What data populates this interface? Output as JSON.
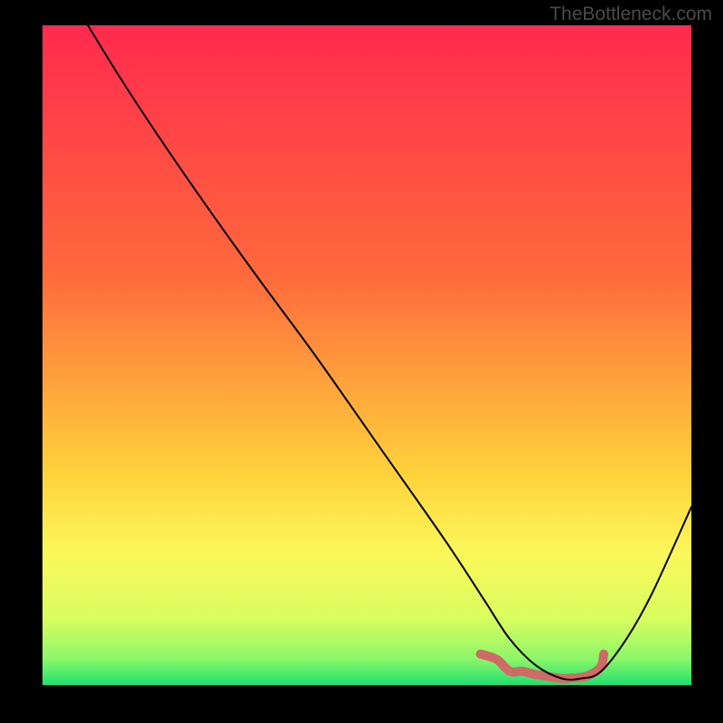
{
  "watermark": "TheBottleneck.com",
  "chart_data": {
    "type": "line",
    "title": "",
    "xlabel": "",
    "ylabel": "",
    "xlim": [
      0,
      100
    ],
    "ylim": [
      0,
      100
    ],
    "gradient_stops": [
      {
        "offset": 0,
        "color": "#ff2a4e"
      },
      {
        "offset": 38,
        "color": "#ff6a3c"
      },
      {
        "offset": 68,
        "color": "#ffd23b"
      },
      {
        "offset": 80,
        "color": "#fbf85a"
      },
      {
        "offset": 90,
        "color": "#d9fd5f"
      },
      {
        "offset": 96,
        "color": "#8cf76a"
      },
      {
        "offset": 100,
        "color": "#1fe071"
      }
    ],
    "curve": {
      "x": [
        7,
        12,
        18,
        25,
        33,
        42,
        52,
        62,
        68,
        72,
        76,
        80,
        83,
        86,
        90,
        94,
        100
      ],
      "values": [
        100,
        92,
        83,
        73,
        62,
        50,
        36,
        22,
        13,
        7,
        3,
        1,
        1,
        2,
        7,
        14,
        27
      ]
    },
    "highlight_trough": {
      "x": [
        67.5,
        70,
        72,
        74,
        76,
        78,
        80,
        82,
        84,
        86,
        86.5
      ],
      "values": [
        4.7,
        3.9,
        2.1,
        2.1,
        1.6,
        1.3,
        1.0,
        1.1,
        1.4,
        2.7,
        4.7
      ],
      "color": "#d06a66",
      "width": 10
    }
  }
}
